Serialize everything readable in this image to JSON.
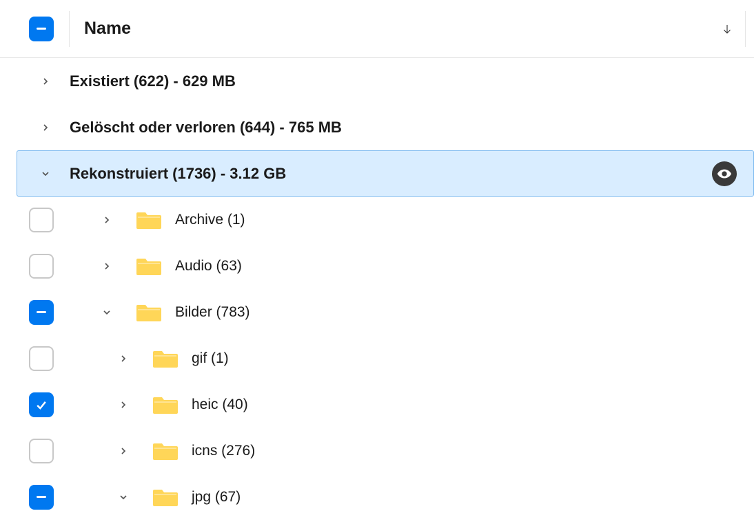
{
  "header": {
    "name_label": "Name"
  },
  "groups": [
    {
      "label": "Existiert (622) - 629 MB",
      "expanded": false,
      "selected": false
    },
    {
      "label": "Gelöscht oder verloren (644) - 765 MB",
      "expanded": false,
      "selected": false
    },
    {
      "label": "Rekonstruiert (1736) - 3.12 GB",
      "expanded": true,
      "selected": true
    }
  ],
  "folders_level1": [
    {
      "label": "Archive (1)",
      "checkbox": "unchecked",
      "expanded": false
    },
    {
      "label": "Audio (63)",
      "checkbox": "unchecked",
      "expanded": false
    },
    {
      "label": "Bilder (783)",
      "checkbox": "indeterminate",
      "expanded": true
    }
  ],
  "folders_level2": [
    {
      "label": "gif (1)",
      "checkbox": "unchecked",
      "expanded": false
    },
    {
      "label": "heic (40)",
      "checkbox": "checked",
      "expanded": false
    },
    {
      "label": "icns (276)",
      "checkbox": "unchecked",
      "expanded": false
    },
    {
      "label": "jpg (67)",
      "checkbox": "indeterminate",
      "expanded": true
    }
  ]
}
